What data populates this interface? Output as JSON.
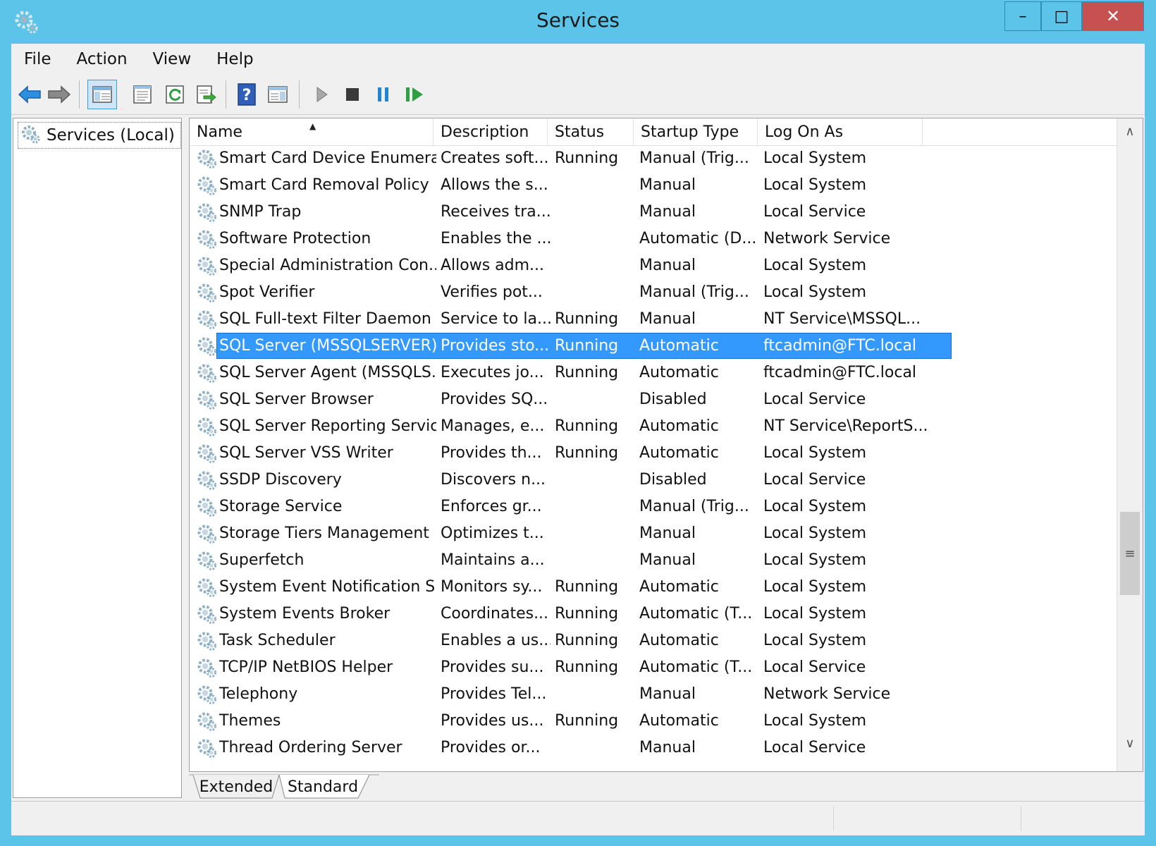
{
  "window": {
    "title": "Services"
  },
  "titlebar_buttons": {
    "minimize": "–",
    "maximize": "□",
    "close": "✕"
  },
  "menu": [
    "File",
    "Action",
    "View",
    "Help"
  ],
  "toolbar_icons": [
    "back-arrow-icon",
    "forward-arrow-icon",
    "show-hide-console-tree-icon",
    "properties-icon",
    "refresh-icon",
    "export-list-icon",
    "help-icon",
    "show-hide-action-pane-icon",
    "start-service-icon",
    "stop-service-icon",
    "pause-service-icon",
    "resume-service-icon"
  ],
  "tree": {
    "root_label": "Services (Local)"
  },
  "columns": {
    "name": "Name",
    "description": "Description",
    "status": "Status",
    "startup_type": "Startup Type",
    "log_on_as": "Log On As"
  },
  "sort": {
    "column": "name",
    "direction": "ascending"
  },
  "rows": [
    {
      "name": "Smart Card Device Enumera...",
      "description": "Creates soft...",
      "status": "Running",
      "startup_type": "Manual (Trig...",
      "log_on_as": "Local System"
    },
    {
      "name": "Smart Card Removal Policy",
      "description": "Allows the s...",
      "status": "",
      "startup_type": "Manual",
      "log_on_as": "Local System"
    },
    {
      "name": "SNMP Trap",
      "description": "Receives tra...",
      "status": "",
      "startup_type": "Manual",
      "log_on_as": "Local Service"
    },
    {
      "name": "Software Protection",
      "description": "Enables the ...",
      "status": "",
      "startup_type": "Automatic (D...",
      "log_on_as": "Network Service"
    },
    {
      "name": "Special Administration Con...",
      "description": "Allows adm...",
      "status": "",
      "startup_type": "Manual",
      "log_on_as": "Local System"
    },
    {
      "name": "Spot Verifier",
      "description": "Verifies pot...",
      "status": "",
      "startup_type": "Manual (Trig...",
      "log_on_as": "Local System"
    },
    {
      "name": "SQL Full-text Filter Daemon ...",
      "description": "Service to la...",
      "status": "Running",
      "startup_type": "Manual",
      "log_on_as": "NT Service\\MSSQL..."
    },
    {
      "name": "SQL Server (MSSQLSERVER)",
      "description": "Provides sto...",
      "status": "Running",
      "startup_type": "Automatic",
      "log_on_as": "ftcadmin@FTC.local",
      "selected": true
    },
    {
      "name": "SQL Server Agent (MSSQLS...",
      "description": "Executes jo...",
      "status": "Running",
      "startup_type": "Automatic",
      "log_on_as": "ftcadmin@FTC.local"
    },
    {
      "name": "SQL Server Browser",
      "description": "Provides SQ...",
      "status": "",
      "startup_type": "Disabled",
      "log_on_as": "Local Service"
    },
    {
      "name": "SQL Server Reporting Servic...",
      "description": "Manages, e...",
      "status": "Running",
      "startup_type": "Automatic",
      "log_on_as": "NT Service\\ReportS..."
    },
    {
      "name": "SQL Server VSS Writer",
      "description": "Provides th...",
      "status": "Running",
      "startup_type": "Automatic",
      "log_on_as": "Local System"
    },
    {
      "name": "SSDP Discovery",
      "description": "Discovers n...",
      "status": "",
      "startup_type": "Disabled",
      "log_on_as": "Local Service"
    },
    {
      "name": "Storage Service",
      "description": "Enforces gr...",
      "status": "",
      "startup_type": "Manual (Trig...",
      "log_on_as": "Local System"
    },
    {
      "name": "Storage Tiers Management",
      "description": "Optimizes t...",
      "status": "",
      "startup_type": "Manual",
      "log_on_as": "Local System"
    },
    {
      "name": "Superfetch",
      "description": "Maintains a...",
      "status": "",
      "startup_type": "Manual",
      "log_on_as": "Local System"
    },
    {
      "name": "System Event Notification S...",
      "description": "Monitors sy...",
      "status": "Running",
      "startup_type": "Automatic",
      "log_on_as": "Local System"
    },
    {
      "name": "System Events Broker",
      "description": "Coordinates...",
      "status": "Running",
      "startup_type": "Automatic (T...",
      "log_on_as": "Local System"
    },
    {
      "name": "Task Scheduler",
      "description": "Enables a us...",
      "status": "Running",
      "startup_type": "Automatic",
      "log_on_as": "Local System"
    },
    {
      "name": "TCP/IP NetBIOS Helper",
      "description": "Provides su...",
      "status": "Running",
      "startup_type": "Automatic (T...",
      "log_on_as": "Local Service"
    },
    {
      "name": "Telephony",
      "description": "Provides Tel...",
      "status": "",
      "startup_type": "Manual",
      "log_on_as": "Network Service"
    },
    {
      "name": "Themes",
      "description": "Provides us...",
      "status": "Running",
      "startup_type": "Automatic",
      "log_on_as": "Local System"
    },
    {
      "name": "Thread Ordering Server",
      "description": "Provides or...",
      "status": "",
      "startup_type": "Manual",
      "log_on_as": "Local Service"
    }
  ],
  "tabs": [
    {
      "label": "Extended",
      "active": false
    },
    {
      "label": "Standard",
      "active": true
    }
  ],
  "scrollbar": {
    "up": "∧",
    "down": "∨",
    "grip": "≡"
  }
}
